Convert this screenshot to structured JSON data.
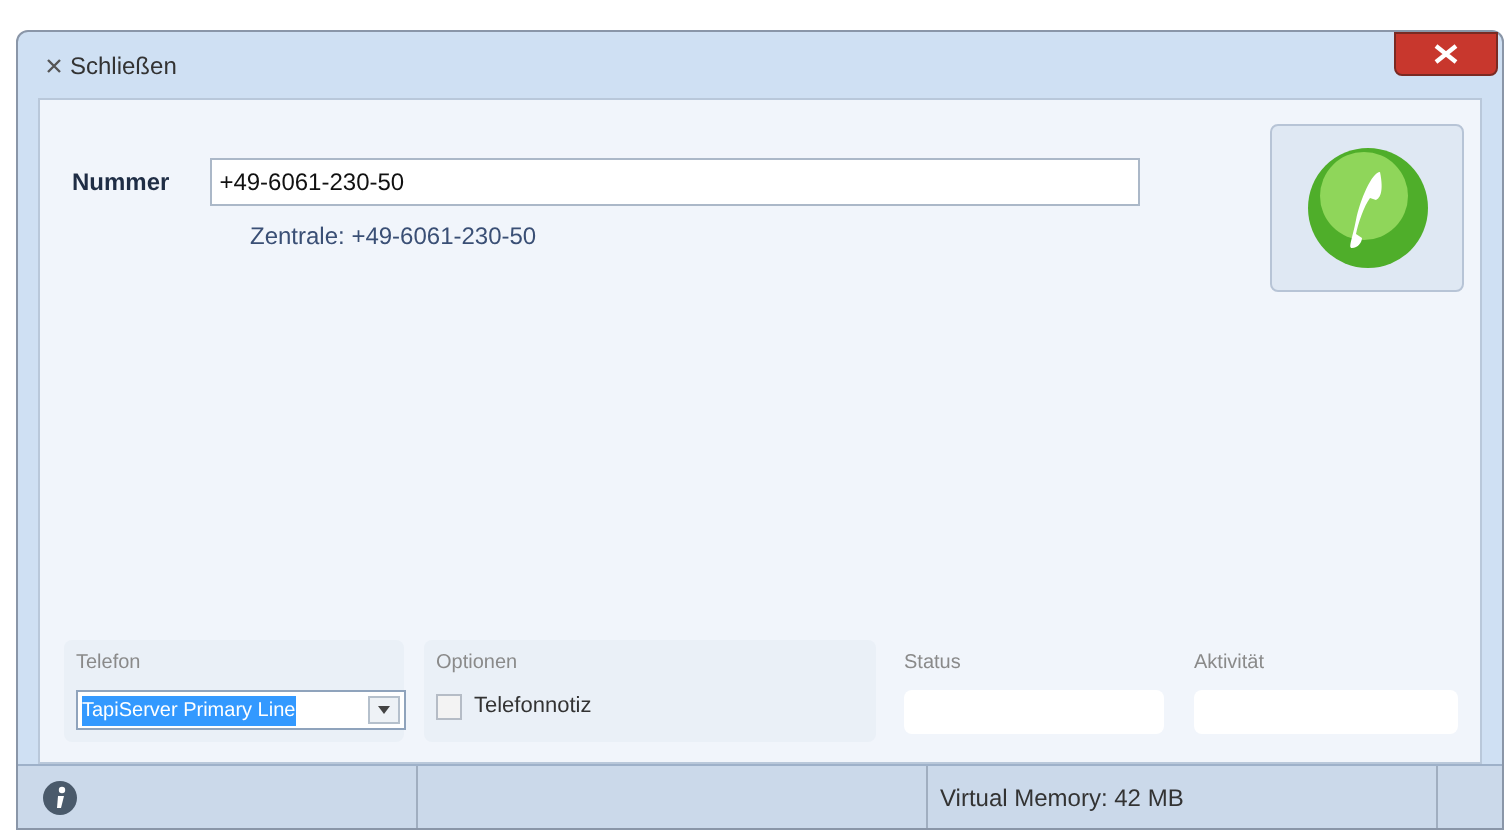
{
  "window": {
    "title": "Schließen"
  },
  "number": {
    "label": "Nummer",
    "value": "+49-6061-230-50"
  },
  "central": "Zentrale: +49-6061-230-50",
  "telefon": {
    "label": "Telefon",
    "value": "TapiServer Primary Line"
  },
  "optionen": {
    "label": "Optionen",
    "checkbox": {
      "label": "Telefonnotiz",
      "checked": false
    }
  },
  "status": {
    "label": "Status"
  },
  "aktivitaet": {
    "label": "Aktivität"
  },
  "status_bar": {
    "memory": "Virtual Memory: 42 MB"
  }
}
